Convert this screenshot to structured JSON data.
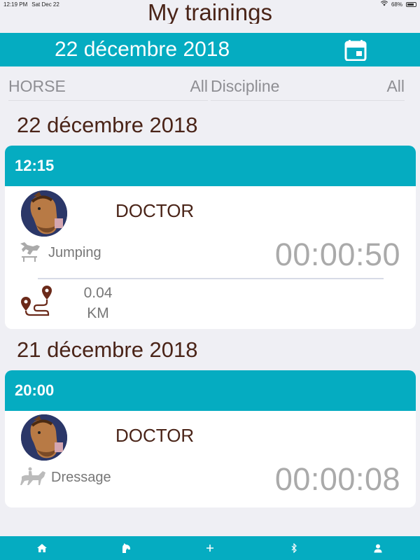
{
  "status_bar": {
    "time": "12:19 PM",
    "date": "Sat Dec 22",
    "battery": "68%"
  },
  "header": {
    "title": "My trainings",
    "date": "22 décembre 2018",
    "calendar_icon": "calendar-icon"
  },
  "filters": {
    "horse_label": "HORSE",
    "horse_value": "All",
    "discipline_label": "Discipline",
    "discipline_value": "All"
  },
  "sections": [
    {
      "date": "22 décembre 2018",
      "training": {
        "time": "12:15",
        "horse": "DOCTOR",
        "discipline": "Jumping",
        "duration": "00:00:50",
        "distance": "0.04",
        "distance_unit": "KM"
      }
    },
    {
      "date": "21 décembre 2018",
      "training": {
        "time": "20:00",
        "horse": "DOCTOR",
        "discipline": "Dressage",
        "duration": "00:00:08"
      }
    }
  ],
  "tab_bar": {
    "tabs": [
      "home-icon",
      "horse-head-icon",
      "plus-icon",
      "bluetooth-icon",
      "profile-icon"
    ]
  },
  "colors": {
    "accent": "#05acc1",
    "title": "#4a2418",
    "background": "#efeff4"
  }
}
